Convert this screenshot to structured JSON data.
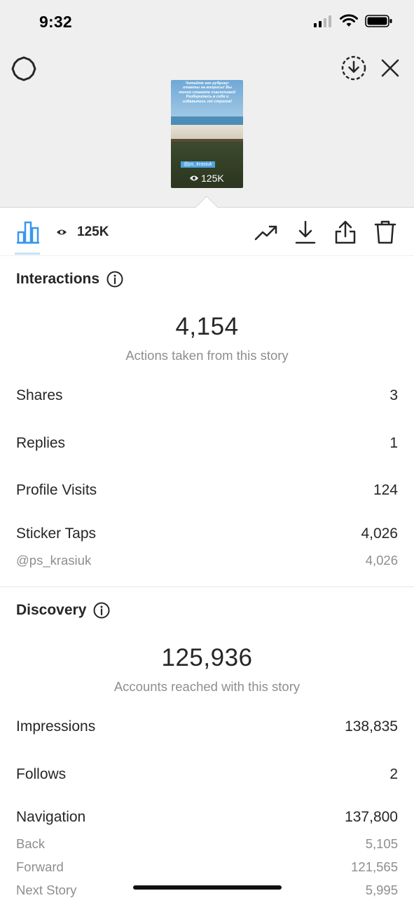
{
  "status_bar": {
    "time": "9:32"
  },
  "story_preview": {
    "overlay_text": "Читайте его рубрику: ответы на вопросы! Вы точно станете счастливей! Разберитесь в себе и избавьтесь от страхов!",
    "mention_tag": "@ps_krasiuk",
    "views": "125K"
  },
  "toolbar": {
    "views": "125K"
  },
  "interactions": {
    "title": "Interactions",
    "total": "4,154",
    "total_label": "Actions taken from this story",
    "rows": [
      {
        "label": "Shares",
        "value": "3"
      },
      {
        "label": "Replies",
        "value": "1"
      },
      {
        "label": "Profile Visits",
        "value": "124"
      },
      {
        "label": "Sticker Taps",
        "value": "4,026"
      }
    ],
    "sticker_sub": {
      "label": "@ps_krasiuk",
      "value": "4,026"
    }
  },
  "discovery": {
    "title": "Discovery",
    "total": "125,936",
    "total_label": "Accounts reached with this story",
    "rows": [
      {
        "label": "Impressions",
        "value": "138,835"
      },
      {
        "label": "Follows",
        "value": "2"
      },
      {
        "label": "Navigation",
        "value": "137,800"
      }
    ],
    "navigation_sub": [
      {
        "label": "Back",
        "value": "5,105"
      },
      {
        "label": "Forward",
        "value": "121,565"
      },
      {
        "label": "Next Story",
        "value": "5,995"
      }
    ]
  },
  "colors": {
    "accent": "#3897f0",
    "text": "#262626",
    "muted": "#8e8e8e",
    "top_bg": "#efefef"
  }
}
